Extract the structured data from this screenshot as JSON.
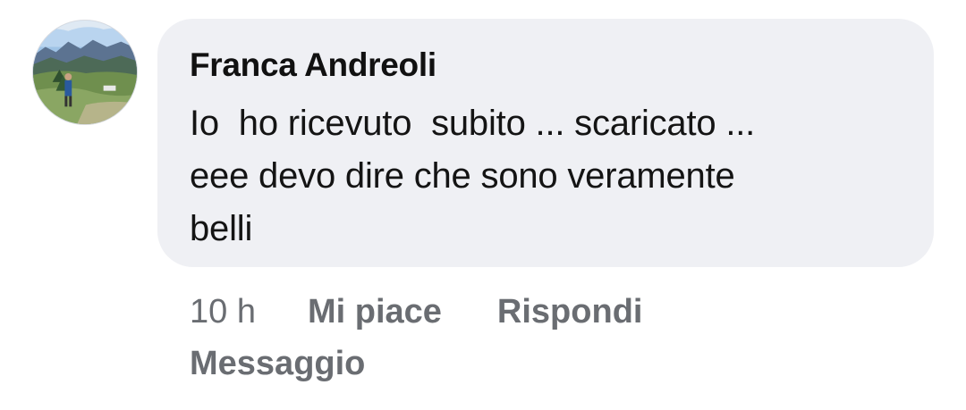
{
  "comment": {
    "author": "Franca Andreoli",
    "text": "Io  ho ricevuto  subito ... scaricato ...\neee devo dire che sono veramente\nbelli",
    "avatar_icon": "profile-photo-mountain-landscape"
  },
  "actions": {
    "time": "10 h",
    "like_label": "Mi piace",
    "reply_label": "Rispondi",
    "message_label": "Messaggio"
  },
  "colors": {
    "bubble_background": "#eff0f4",
    "action_text": "#6a6d72",
    "author_text": "#111111"
  }
}
